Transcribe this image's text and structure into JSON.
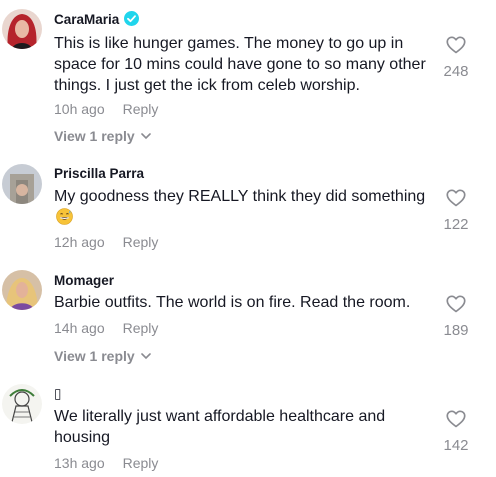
{
  "comments": [
    {
      "username": "CaraMaria",
      "verified": true,
      "text": "This is like hunger games. The money to go up in space for 10 mins could have gone to so many other things. I just get the ick from celeb worship.",
      "time": "10h ago",
      "reply_label": "Reply",
      "likes": "248",
      "view_replies": "View 1 reply"
    },
    {
      "username": "Priscilla Parra",
      "text": "My goodness they REALLY think they did something",
      "time": "12h ago",
      "reply_label": "Reply",
      "likes": "122"
    },
    {
      "username": "Momager",
      "text": "Barbie outfits. The world is on fire. Read the room.",
      "time": "14h ago",
      "reply_label": "Reply",
      "likes": "189",
      "view_replies": "View 1 reply"
    },
    {
      "username": "▯",
      "text": "We literally just want affordable healthcare and housing",
      "time": "13h ago",
      "reply_label": "Reply",
      "likes": "142"
    }
  ],
  "icons": {
    "verified": "verified-badge-icon",
    "like": "heart-outline-icon",
    "chevron": "chevron-down-icon",
    "emoji": "grinning-sweat-emoji"
  },
  "colors": {
    "text": "#161823",
    "muted": "#8a8b91",
    "verified": "#20d5ec"
  }
}
